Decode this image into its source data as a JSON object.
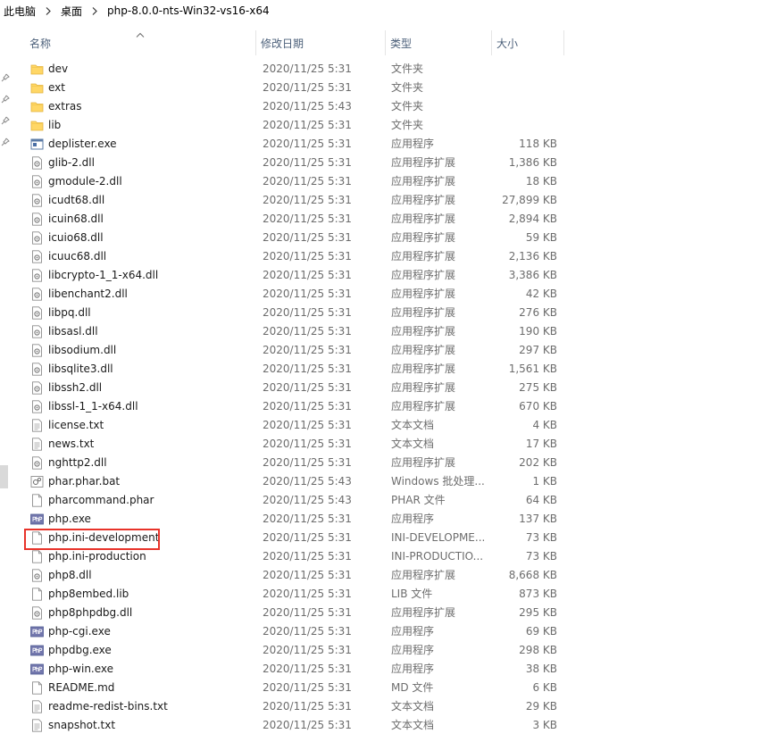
{
  "breadcrumb": {
    "items": [
      "此电脑",
      "桌面",
      "php-8.0.0-nts-Win32-vs16-x64"
    ]
  },
  "columns": {
    "name": "名称",
    "date": "修改日期",
    "type": "类型",
    "size": "大小"
  },
  "colors": {
    "header_text": "#4c607a",
    "muted_text": "#6d6d6d",
    "folder": "#ffd766",
    "highlight_border": "#e8332a"
  },
  "files": [
    {
      "name": "dev",
      "date": "2020/11/25 5:31",
      "type": "文件夹",
      "size": "",
      "icon": "folder-icon"
    },
    {
      "name": "ext",
      "date": "2020/11/25 5:31",
      "type": "文件夹",
      "size": "",
      "icon": "folder-icon"
    },
    {
      "name": "extras",
      "date": "2020/11/25 5:43",
      "type": "文件夹",
      "size": "",
      "icon": "folder-icon"
    },
    {
      "name": "lib",
      "date": "2020/11/25 5:31",
      "type": "文件夹",
      "size": "",
      "icon": "folder-icon"
    },
    {
      "name": "deplister.exe",
      "date": "2020/11/25 5:31",
      "type": "应用程序",
      "size": "118 KB",
      "icon": "exe-icon"
    },
    {
      "name": "glib-2.dll",
      "date": "2020/11/25 5:31",
      "type": "应用程序扩展",
      "size": "1,386 KB",
      "icon": "dll-icon"
    },
    {
      "name": "gmodule-2.dll",
      "date": "2020/11/25 5:31",
      "type": "应用程序扩展",
      "size": "18 KB",
      "icon": "dll-icon"
    },
    {
      "name": "icudt68.dll",
      "date": "2020/11/25 5:31",
      "type": "应用程序扩展",
      "size": "27,899 KB",
      "icon": "dll-icon"
    },
    {
      "name": "icuin68.dll",
      "date": "2020/11/25 5:31",
      "type": "应用程序扩展",
      "size": "2,894 KB",
      "icon": "dll-icon"
    },
    {
      "name": "icuio68.dll",
      "date": "2020/11/25 5:31",
      "type": "应用程序扩展",
      "size": "59 KB",
      "icon": "dll-icon"
    },
    {
      "name": "icuuc68.dll",
      "date": "2020/11/25 5:31",
      "type": "应用程序扩展",
      "size": "2,136 KB",
      "icon": "dll-icon"
    },
    {
      "name": "libcrypto-1_1-x64.dll",
      "date": "2020/11/25 5:31",
      "type": "应用程序扩展",
      "size": "3,386 KB",
      "icon": "dll-icon"
    },
    {
      "name": "libenchant2.dll",
      "date": "2020/11/25 5:31",
      "type": "应用程序扩展",
      "size": "42 KB",
      "icon": "dll-icon"
    },
    {
      "name": "libpq.dll",
      "date": "2020/11/25 5:31",
      "type": "应用程序扩展",
      "size": "276 KB",
      "icon": "dll-icon"
    },
    {
      "name": "libsasl.dll",
      "date": "2020/11/25 5:31",
      "type": "应用程序扩展",
      "size": "190 KB",
      "icon": "dll-icon"
    },
    {
      "name": "libsodium.dll",
      "date": "2020/11/25 5:31",
      "type": "应用程序扩展",
      "size": "297 KB",
      "icon": "dll-icon"
    },
    {
      "name": "libsqlite3.dll",
      "date": "2020/11/25 5:31",
      "type": "应用程序扩展",
      "size": "1,561 KB",
      "icon": "dll-icon"
    },
    {
      "name": "libssh2.dll",
      "date": "2020/11/25 5:31",
      "type": "应用程序扩展",
      "size": "275 KB",
      "icon": "dll-icon"
    },
    {
      "name": "libssl-1_1-x64.dll",
      "date": "2020/11/25 5:31",
      "type": "应用程序扩展",
      "size": "670 KB",
      "icon": "dll-icon"
    },
    {
      "name": "license.txt",
      "date": "2020/11/25 5:31",
      "type": "文本文档",
      "size": "4 KB",
      "icon": "text-file-icon"
    },
    {
      "name": "news.txt",
      "date": "2020/11/25 5:31",
      "type": "文本文档",
      "size": "17 KB",
      "icon": "text-file-icon"
    },
    {
      "name": "nghttp2.dll",
      "date": "2020/11/25 5:31",
      "type": "应用程序扩展",
      "size": "202 KB",
      "icon": "dll-icon"
    },
    {
      "name": "phar.phar.bat",
      "date": "2020/11/25 5:43",
      "type": "Windows 批处理...",
      "size": "1 KB",
      "icon": "batch-file-icon"
    },
    {
      "name": "pharcommand.phar",
      "date": "2020/11/25 5:43",
      "type": "PHAR 文件",
      "size": "64 KB",
      "icon": "blank-file-icon"
    },
    {
      "name": "php.exe",
      "date": "2020/11/25 5:31",
      "type": "应用程序",
      "size": "137 KB",
      "icon": "php-icon"
    },
    {
      "name": "php.ini-development",
      "date": "2020/11/25 5:31",
      "type": "INI-DEVELOPME...",
      "size": "73 KB",
      "icon": "blank-file-icon"
    },
    {
      "name": "php.ini-production",
      "date": "2020/11/25 5:31",
      "type": "INI-PRODUCTIO...",
      "size": "73 KB",
      "icon": "blank-file-icon"
    },
    {
      "name": "php8.dll",
      "date": "2020/11/25 5:31",
      "type": "应用程序扩展",
      "size": "8,668 KB",
      "icon": "dll-icon"
    },
    {
      "name": "php8embed.lib",
      "date": "2020/11/25 5:31",
      "type": "LIB 文件",
      "size": "873 KB",
      "icon": "blank-file-icon"
    },
    {
      "name": "php8phpdbg.dll",
      "date": "2020/11/25 5:31",
      "type": "应用程序扩展",
      "size": "295 KB",
      "icon": "dll-icon"
    },
    {
      "name": "php-cgi.exe",
      "date": "2020/11/25 5:31",
      "type": "应用程序",
      "size": "69 KB",
      "icon": "php-icon"
    },
    {
      "name": "phpdbg.exe",
      "date": "2020/11/25 5:31",
      "type": "应用程序",
      "size": "298 KB",
      "icon": "php-icon"
    },
    {
      "name": "php-win.exe",
      "date": "2020/11/25 5:31",
      "type": "应用程序",
      "size": "38 KB",
      "icon": "php-icon"
    },
    {
      "name": "README.md",
      "date": "2020/11/25 5:31",
      "type": "MD 文件",
      "size": "6 KB",
      "icon": "blank-file-icon"
    },
    {
      "name": "readme-redist-bins.txt",
      "date": "2020/11/25 5:31",
      "type": "文本文档",
      "size": "29 KB",
      "icon": "text-file-icon"
    },
    {
      "name": "snapshot.txt",
      "date": "2020/11/25 5:31",
      "type": "文本文档",
      "size": "3 KB",
      "icon": "text-file-icon"
    }
  ]
}
